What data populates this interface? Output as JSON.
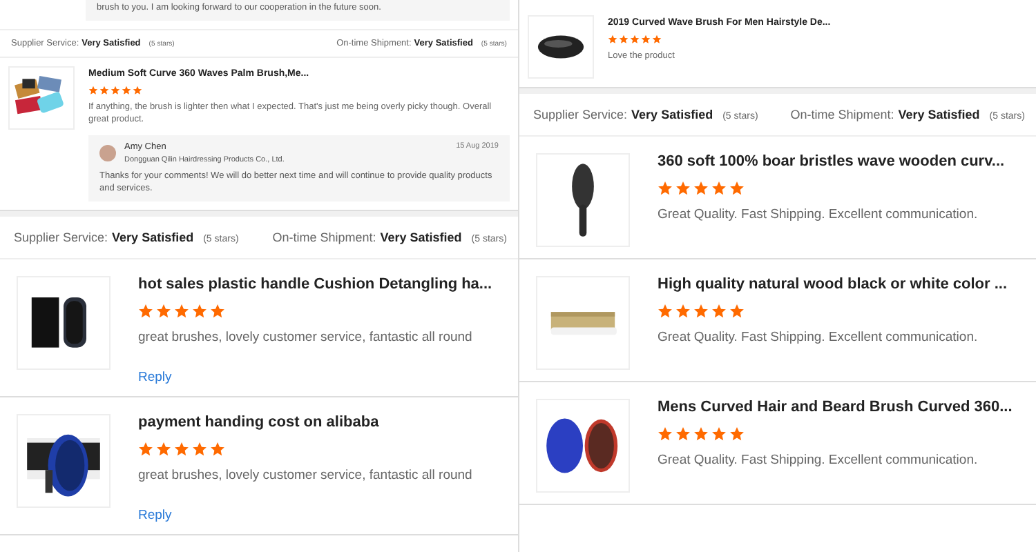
{
  "columns": [
    {
      "items": [
        {
          "kind": "replytail",
          "text": "brush to you. I am looking forward to our cooperation in the future soon."
        },
        {
          "kind": "rating",
          "compact": true,
          "supplier_label": "Supplier Service:",
          "supplier_value": "Very Satisfied",
          "supplier_stars": "(5 stars)",
          "shipment_label": "On-time Shipment:",
          "shipment_value": "Very Satisfied",
          "shipment_stars": "(5 stars)"
        },
        {
          "kind": "review",
          "compact": true,
          "title": "Medium Soft Curve 360 Waves Palm Brush,Me...",
          "stars": 5,
          "comment": "If anything, the brush is lighter then what I expected. That's just me being overly picky though. Overall great product.",
          "response": {
            "author": "Amy Chen",
            "company": "Dongguan Qilin Hairdressing Products Co., Ltd.",
            "date": "15 Aug 2019",
            "text": "Thanks for your comments! We will do better next time and will continue to provide quality products and services."
          }
        },
        {
          "kind": "rating",
          "compact": false,
          "supplier_label": "Supplier Service:",
          "supplier_value": "Very Satisfied",
          "supplier_stars": "(5 stars)",
          "shipment_label": "On-time Shipment:",
          "shipment_value": "Very Satisfied",
          "shipment_stars": "(5 stars)"
        },
        {
          "kind": "review",
          "compact": false,
          "title": "hot sales plastic handle Cushion Detangling ha...",
          "stars": 5,
          "comment": "great brushes, lovely customer service, fantastic all round",
          "reply_link": "Reply"
        },
        {
          "kind": "review",
          "compact": false,
          "title": "payment handing cost on alibaba",
          "stars": 5,
          "comment": "great brushes, lovely customer service, fantastic all round",
          "reply_link": "Reply"
        }
      ]
    },
    {
      "items": [
        {
          "kind": "review",
          "compact": true,
          "title": "2019 Curved Wave Brush For Men Hairstyle De...",
          "stars": 5,
          "comment": "Love the product"
        },
        {
          "kind": "rating",
          "compact": false,
          "supplier_label": "Supplier Service:",
          "supplier_value": "Very Satisfied",
          "supplier_stars": "(5 stars)",
          "shipment_label": "On-time Shipment:",
          "shipment_value": "Very Satisfied",
          "shipment_stars": "(5 stars)"
        },
        {
          "kind": "review",
          "compact": false,
          "title": "360 soft 100% boar bristles wave wooden curv...",
          "stars": 5,
          "comment": "Great Quality. Fast Shipping. Excellent communication."
        },
        {
          "kind": "review",
          "compact": false,
          "title": "High quality natural wood black or white color ...",
          "stars": 5,
          "comment": "Great Quality. Fast Shipping. Excellent communication."
        },
        {
          "kind": "review",
          "compact": false,
          "title": "Mens Curved Hair and Beard Brush Curved 360...",
          "stars": 5,
          "comment": "Great Quality. Fast Shipping. Excellent communication."
        }
      ]
    }
  ]
}
